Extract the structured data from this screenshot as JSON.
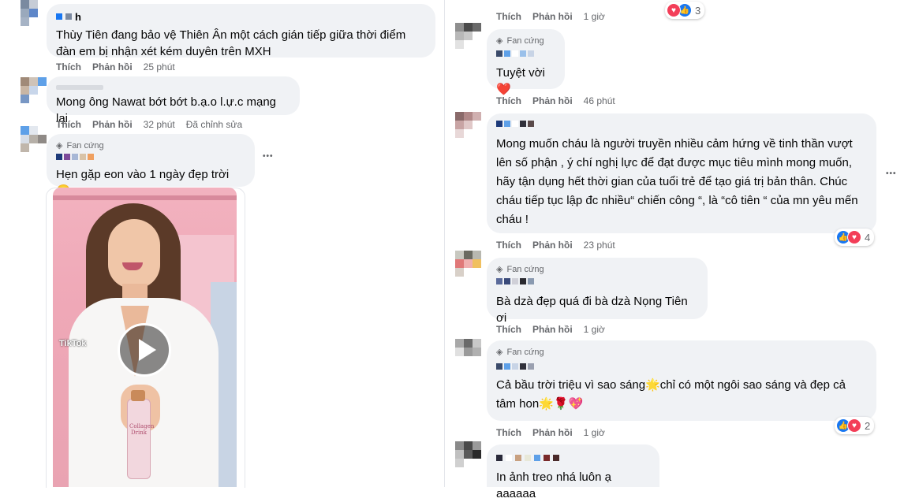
{
  "left_column": {
    "c1": {
      "name": "h",
      "text": "Thùy Tiên đang bảo vệ Thiên Ân một cách gián tiếp giữa thời điểm đàn em bị nhận xét kém duyên trên MXH",
      "like": "Thích",
      "reply": "Phản hồi",
      "time": "25 phút"
    },
    "c2": {
      "text": "Mong ông Nawat bớt bớt b.ạ.o l.ự.c mạng lại",
      "like": "Thích",
      "reply": "Phản hồi",
      "time": "32 phút",
      "edited": "Đã chỉnh sửa"
    },
    "c3": {
      "badge": "Fan cứng",
      "text": "Hẹn gặp eon vào 1 ngày đẹp trời 😄",
      "more": "•••"
    },
    "video": {
      "watermark": "TikTok",
      "product_label": "Collagen Drink",
      "play_icon": "play-icon"
    }
  },
  "right_column": {
    "c0": {
      "like": "Thích",
      "reply": "Phản hồi",
      "time": "1 giờ",
      "reaction_count": "3"
    },
    "c1": {
      "badge": "Fan cứng",
      "text": "Tuyệt vời❤️",
      "like": "Thích",
      "reply": "Phản hồi",
      "time": "46 phút"
    },
    "c2": {
      "text": "Mong muốn cháu là người truyền nhiều cảm hứng về tinh thần vượt lên số phận , ý chí nghị lực để đạt được mục tiêu mình mong muốn, hãy tận dụng hết thời gian của tuổi trẻ để tạo giá trị bản thân. Chúc cháu tiếp tục lập đc nhiều“ chiến công “, là “cô tiên “ của mn yêu mến cháu !",
      "like": "Thích",
      "reply": "Phản hồi",
      "time": "23 phút",
      "reaction_count": "4",
      "more": "•••"
    },
    "c3": {
      "badge": "Fan cứng",
      "text": "Bà dzà đẹp quá đi bà dzà Nọng Tiên ơi",
      "like": "Thích",
      "reply": "Phản hồi",
      "time": "1 giờ"
    },
    "c4": {
      "badge": "Fan cứng",
      "text": "Cả bầu trời triệu vì sao sáng🌟chỉ có một ngôi sao sáng và đẹp cả tâm hon🌟🌹💖",
      "like": "Thích",
      "reply": "Phản hồi",
      "time": "1 giờ",
      "reaction_count": "2"
    },
    "c5": {
      "text": "In ảnh treo nhá luôn ạ aaaaaa"
    }
  },
  "colors": {
    "bubble": "#f0f2f5",
    "meta": "#65676b",
    "like_blue": "#1877f2",
    "love_red": "#f33e58"
  }
}
